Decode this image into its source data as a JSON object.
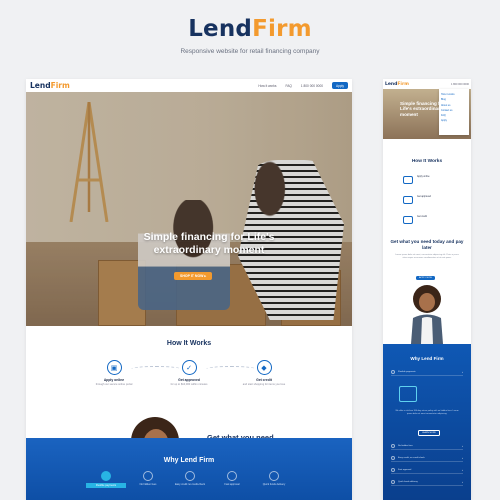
{
  "brand": {
    "name_part1": "Lend",
    "name_part2": "Firm",
    "subtitle": "Responsive website for retail financing company"
  },
  "desktop": {
    "nav": {
      "logo_part1": "Lend",
      "logo_part2": "Firm",
      "links": [
        "How it works",
        "FAQ",
        "1 800 000 0000"
      ],
      "cta": "Apply"
    },
    "hero": {
      "title": "Simple financing for Life's extraordinary moment",
      "button": "SHOP IT NOW ▸"
    },
    "how": {
      "title": "How It Works",
      "steps": [
        {
          "label": "Apply online",
          "desc": "through our secure online portal"
        },
        {
          "label": "Get approved",
          "desc": "for up to $10,000 within minutes"
        },
        {
          "label": "Get credit",
          "desc": "and start shopping for items you love"
        }
      ]
    },
    "get": {
      "title": "Get what you need today and pay later",
      "body": "Lorem ipsum dolor sit amet, consectetur adipiscing elit. Proin a purus vitae neque accumsan condimentum ut at at erat quam. Mauris malesuada et porttitor convallis at nisi accumsan quam eget pulvinar dignissim.",
      "button": "APPLY NOW"
    },
    "why": {
      "title": "Why Lend Firm",
      "items": [
        "Flexible payments",
        "No hidden fees",
        "Easy credit no credit‑check",
        "Fast approval",
        "Quick funds delivery"
      ]
    }
  },
  "mobile": {
    "nav": {
      "logo_part1": "Lend",
      "logo_part2": "Firm",
      "extra": "1 800 000 0000"
    },
    "menu": [
      "How it works",
      "Blog",
      "About us",
      "Contact us",
      "FAQ",
      "Apply"
    ],
    "hero_title": "Simple financing for Life's extraordinary moment",
    "how_title": "How It Works",
    "steps": [
      "Apply online",
      "Get approved",
      "Get credit"
    ],
    "get_title": "Get what you need today and pay later",
    "get_body": "Lorem ipsum dolor sit amet, consectetur adipiscing elit. Proin a purus vitae neque accumsan condimentum ut at erat quam.",
    "get_button": "APPLY NOW",
    "why_title": "Why Lend Firm",
    "accordion": [
      "Flexible payments",
      "No hidden fees",
      "Easy credit, no credit check",
      "Fast approval",
      "Quick funds delivery"
    ],
    "feature_text": "We offer a risk-free 100-day return policy with no hidden fees. Lorem ipsum dolor sit amet consectetur adipiscing.",
    "feature_button": "LEARN MORE"
  },
  "colors": {
    "navy": "#17325f",
    "orange": "#f39a2e",
    "blue": "#1268c4",
    "cyan": "#28b4e4"
  }
}
